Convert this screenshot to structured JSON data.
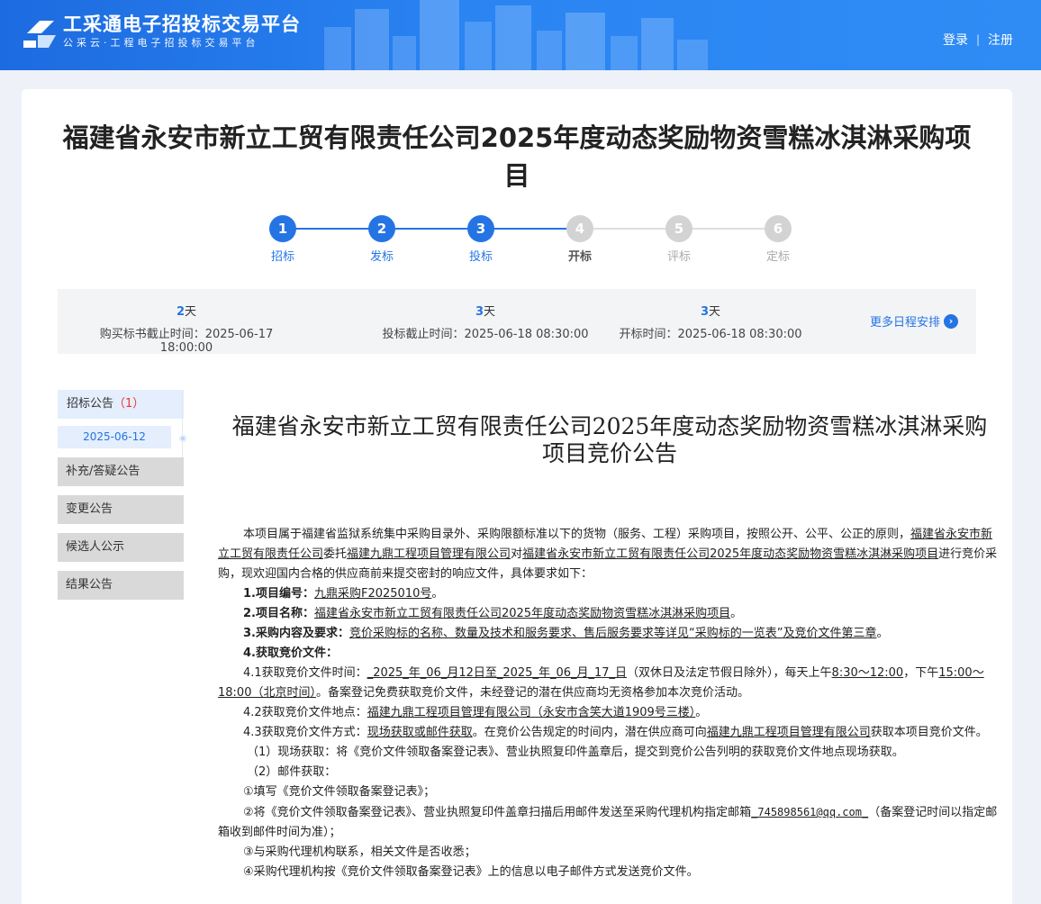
{
  "header": {
    "logo_title": "工采通电子招投标交易平台",
    "logo_sub": "公采云·工程电子招投标交易平台",
    "login": "登录",
    "separator": "|",
    "register": "注册"
  },
  "project_title": "福建省永安市新立工贸有限责任公司2025年度动态奖励物资雪糕冰淇淋采购项目",
  "steps": [
    {
      "num": "1",
      "label": "招标",
      "state": "done"
    },
    {
      "num": "2",
      "label": "发标",
      "state": "done"
    },
    {
      "num": "3",
      "label": "投标",
      "state": "done"
    },
    {
      "num": "4",
      "label": "开标",
      "state": "current"
    },
    {
      "num": "5",
      "label": "评标",
      "state": "todo"
    },
    {
      "num": "6",
      "label": "定标",
      "state": "todo"
    }
  ],
  "schedule": {
    "items": [
      {
        "days": "2",
        "unit": "天",
        "label": "购买标书截止时间：2025-06-17 18:00:00"
      },
      {
        "days": "3",
        "unit": "天",
        "label": "投标截止时间：2025-06-18 08:30:00"
      },
      {
        "days": "3",
        "unit": "天",
        "label": "开标时间：2025-06-18 08:30:00"
      }
    ],
    "more": "更多日程安排",
    "more_arrow": "›"
  },
  "sidebar": {
    "head_label": "招标公告",
    "head_count": "（1）",
    "date": "2025-06-12",
    "items": [
      "补充/答疑公告",
      "变更公告",
      "候选人公示",
      "结果公告"
    ]
  },
  "doc": {
    "title": "福建省永安市新立工贸有限责任公司2025年度动态奖励物资雪糕冰淇淋采购项目竞价公告",
    "intro_a": "本项目属于福建省监狱系统集中采购目录外、采购限额标准以下的货物（服务、工程）采购项目，按照公开、公平、公正的原则，",
    "intro_u1": "福建省永安市新立工贸有限责任公司",
    "intro_b": "委托",
    "intro_u2": "福建九鼎工程项目管理有限公司",
    "intro_c": "对",
    "intro_u3": "福建省永安市新立工贸有限责任公司2025年度动态奖励物资雪糕冰淇淋采购项目",
    "intro_d": "进行竞价采购，现欢迎国内合格的供应商前来提交密封的响应文件，具体要求如下：",
    "item1_k": "1.项目编号：",
    "item1_v": "九鼎采购F2025010号",
    "item1_end": "。",
    "item2_k": "2.项目名称：",
    "item2_v": "福建省永安市新立工贸有限责任公司2025年度动态奖励物资雪糕冰淇淋采购项目",
    "item2_end": "。",
    "item3_k": "3.采购内容及要求：",
    "item3_v": "竞价采购标的名称、数量及技术和服务要求、售后服务要求等详见“采购标的一览表”及竞价文件第三章",
    "item3_end": "。",
    "item4_k": "4.获取竞价文件：",
    "s41_a": "4.1获取竞价文件时间：",
    "s41_d1": "_2025_年_06_月12日至_2025_年_06_月_17_日",
    "s41_b": "（双休日及法定节假日除外），每天上午",
    "s41_t1": "8:30～12:00",
    "s41_c": "，下午",
    "s41_t2": "15:00～18:00（北京时间）",
    "s41_d": "。备案登记免费获取竞价文件，未经登记的潜在供应商均无资格参加本次竞价活动。",
    "s42_a": "4.2获取竞价文件地点：",
    "s42_u": "福建九鼎工程项目管理有限公司（永安市含笑大道1909号三楼）",
    "s42_end": "。",
    "s43_a": "4.3获取竞价文件方式：",
    "s43_u1": "现场获取或邮件获取",
    "s43_b": "。在竞价公告规定的时间内，潜在供应商可向",
    "s43_u2": "福建九鼎工程项目管理有限公司",
    "s43_c": "获取本项目竞价文件。",
    "p1": "（1）现场获取：将《竞价文件领取备案登记表》、营业执照复印件盖章后，提交到竞价公告列明的获取竞价文件地点现场获取。",
    "p2": "（2）邮件获取：",
    "c1": "①填写《竞价文件领取备案登记表》；",
    "c2_a": "②将《竞价文件领取备案登记表》、营业执照复印件盖章扫描后用邮件发送至采购代理机构指定邮箱",
    "c2_u": "_745898561@qq.com_",
    "c2_b": "（备案登记时间以指定邮箱收到邮件时间为准）；",
    "c3": "③与采购代理机构联系，相关文件是否收悉；",
    "c4": "④采购代理机构按《竞价文件领取备案登记表》上的信息以电子邮件方式发送竞价文件。"
  }
}
